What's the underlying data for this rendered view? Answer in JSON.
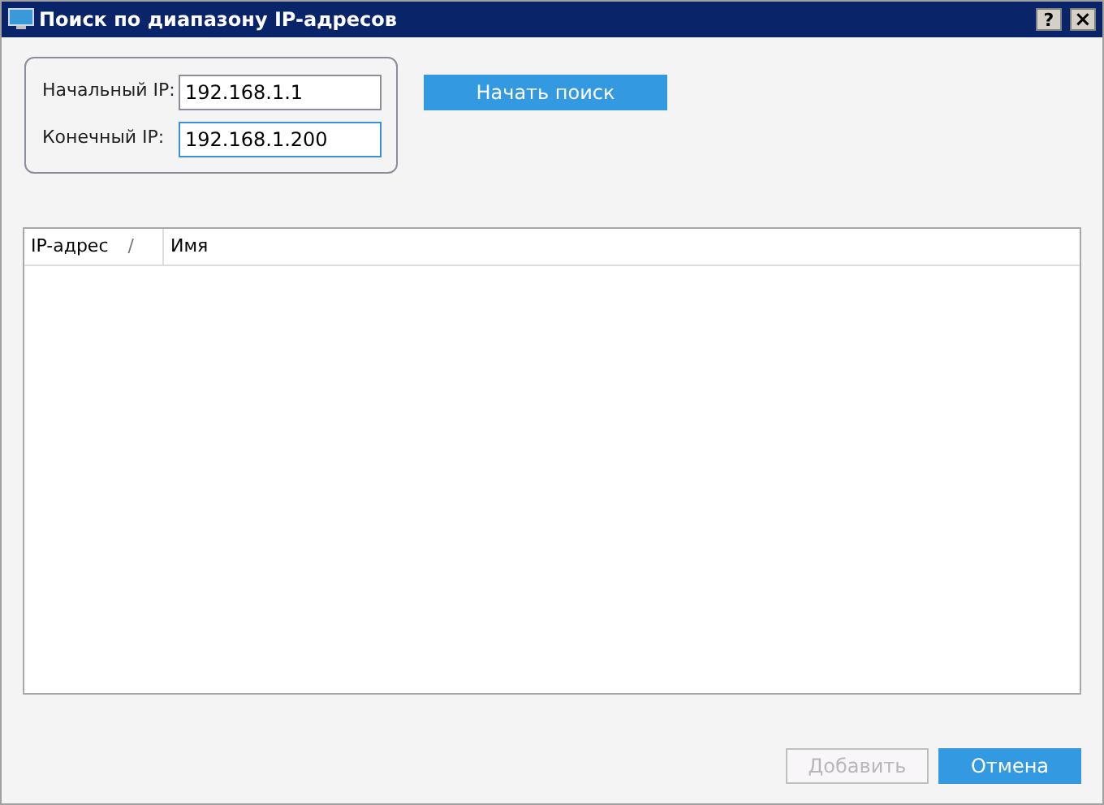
{
  "window": {
    "title": "Поиск по диапазону IP-адресов",
    "help": "?",
    "close": "×"
  },
  "fields": [
    {
      "label": "Начальный IP:",
      "value": "192.168.1.1",
      "focused": false
    },
    {
      "label": "Конечный IP:",
      "value": "192.168.1.200",
      "focused": true
    }
  ],
  "search_button": "Начать поиск",
  "table": {
    "columns": [
      {
        "label": "IP-адрес",
        "sort": "/"
      },
      {
        "label": "Имя"
      }
    ]
  },
  "buttons": [
    {
      "label": "Добавить",
      "disabled": true
    },
    {
      "label": "Отмена",
      "disabled": false
    }
  ]
}
